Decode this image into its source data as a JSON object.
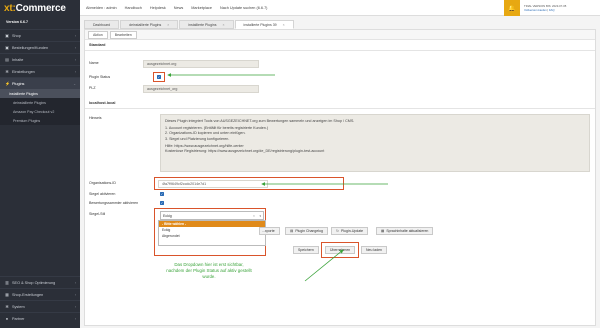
{
  "brand": {
    "logo_xt": "xt:",
    "logo_rest": "Commerce",
    "version": "Version 6.6.7"
  },
  "sidebar": {
    "items": [
      {
        "label": "Shop",
        "icon": "cart-icon"
      },
      {
        "label": "Bestellungen/Kunden",
        "icon": "cart-icon"
      },
      {
        "label": "Inhalte",
        "icon": "file-icon"
      },
      {
        "label": "Einstellungen",
        "icon": "gear-icon"
      },
      {
        "label": "Plugins",
        "icon": "plug-icon"
      }
    ],
    "sub_items": [
      {
        "label": "installierte Plugins"
      },
      {
        "label": "deinstallierte Plugins"
      },
      {
        "label": "Amazon Pay Checkout v2"
      },
      {
        "label": "Premium Plugins"
      }
    ],
    "bottom_items": [
      {
        "label": "SEO & Shop Optimierung",
        "icon": "chart-icon"
      },
      {
        "label": "Shop-Erstellungen",
        "icon": "store-icon"
      },
      {
        "label": "System",
        "icon": "gear-icon"
      },
      {
        "label": "Partner",
        "icon": "user-icon"
      }
    ]
  },
  "topbar": {
    "nav": [
      "Abmelden : admin",
      "Handbuch",
      "Helpdesk",
      "News",
      "Marketplace",
      "Nach Update suchen (6.6.7)"
    ],
    "info_line1": "TRIAL VERSION BIS: 2023-07-05",
    "info_line2_a": "Vollversion kaufen",
    "info_line2_b": "FAQ"
  },
  "tabs": [
    {
      "label": "Dashboard"
    },
    {
      "label": "deinstallierte Plugins"
    },
    {
      "label": "installierte Plugins"
    },
    {
      "label": "installierte Plugins 39"
    }
  ],
  "actions": {
    "aktion": "Aktion",
    "bearbeiten": "Bearbeiten"
  },
  "form": {
    "section_standard": "Standard",
    "name_label": "Name",
    "name_value": "ausgezeichnet.org",
    "status_label": "Plugin Status",
    "plz_label": "PLZ",
    "plz_value": "ausgezeichnet_org",
    "section_local": "localhost.local",
    "hinweis_label": "Hinweis",
    "hinweis_lines": [
      "Dieses Plugin integriert Tools von AUSGEZEICHNET.org zum Bewertungen sammeln und anzeigen im Shop / CMS.",
      "1. Account registrieren. (Entfällt für bereits registrierte Kunden.)",
      "2. Organizations-ID kopieren und unten einfügen.",
      "3. Siegel und Platzierung konfigurieren.",
      "Hilfe: https://www.ausgezeichnet.org/hilfe-center",
      "Kostenlose Registrierung: https://www.ausgezeichnet.org/de_DE/registrierung/plugin-test-account"
    ],
    "org_label": "Organisations-ID",
    "org_value": "4fa7f9649cf2ccdc2014e7d1",
    "siegel_aktiv_label": "Siegel aktivieren",
    "bewertung_label": "Bewertungssammler aktivieren",
    "siegel_stil_label": "Siegel-Stil",
    "select_value": "Eckig",
    "dropdown_options": [
      "- Bitte wählen -",
      "Eckig",
      "Abgerundet"
    ]
  },
  "buttons": {
    "export": "...xporte",
    "changelog": "Plugin Changelog",
    "update": "Plugin-Update",
    "sprachinhalte": "Sprachinhalte aktualisieren",
    "speichern": "Speichern",
    "uebernehmen": "Übernehmen",
    "neu_laden": "Neu laden"
  },
  "note": "Das Dropdown hier ist erst sichtbar, nachdem der Plugin Status auf aktiv gestellt wurde.",
  "colors": {
    "accent": "#e7a812",
    "highlight": "#d9542b",
    "arrow": "#3aa33a",
    "dropdown_selected": "#e08a1a"
  }
}
